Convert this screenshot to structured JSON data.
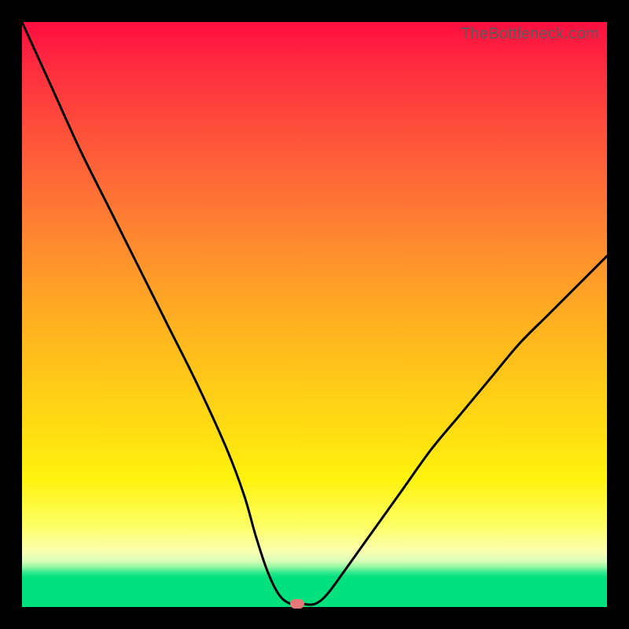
{
  "watermark": "TheBottleneck.com",
  "chart_data": {
    "type": "line",
    "title": "",
    "xlabel": "",
    "ylabel": "",
    "xlim": [
      0,
      100
    ],
    "ylim": [
      0,
      100
    ],
    "x": [
      0,
      5,
      10,
      15,
      20,
      25,
      30,
      35,
      38,
      40,
      42,
      44,
      46,
      48,
      50,
      52,
      55,
      60,
      65,
      70,
      75,
      80,
      85,
      90,
      95,
      100
    ],
    "values": [
      100,
      89,
      78,
      68,
      58,
      48,
      38,
      27,
      19,
      12,
      6,
      2,
      0.5,
      0.5,
      0.5,
      2,
      6,
      13,
      20,
      27,
      33,
      39,
      45,
      50,
      55,
      60
    ],
    "marker": {
      "x": 47,
      "y": 0.5
    },
    "gradient_stops": [
      {
        "pct": 0,
        "color": "#ff0e3f"
      },
      {
        "pct": 8,
        "color": "#ff2d3f"
      },
      {
        "pct": 22,
        "color": "#ff5a3a"
      },
      {
        "pct": 38,
        "color": "#ff8b2f"
      },
      {
        "pct": 52,
        "color": "#ffb220"
      },
      {
        "pct": 66,
        "color": "#ffd414"
      },
      {
        "pct": 78,
        "color": "#fff20d"
      },
      {
        "pct": 86,
        "color": "#feff62"
      },
      {
        "pct": 90.5,
        "color": "#faffb0"
      },
      {
        "pct": 92.2,
        "color": "#d7ffb8"
      },
      {
        "pct": 93.2,
        "color": "#8ef7a0"
      },
      {
        "pct": 94.2,
        "color": "#28e88a"
      },
      {
        "pct": 95.0,
        "color": "#00e07c"
      },
      {
        "pct": 100,
        "color": "#00e07c"
      }
    ]
  }
}
